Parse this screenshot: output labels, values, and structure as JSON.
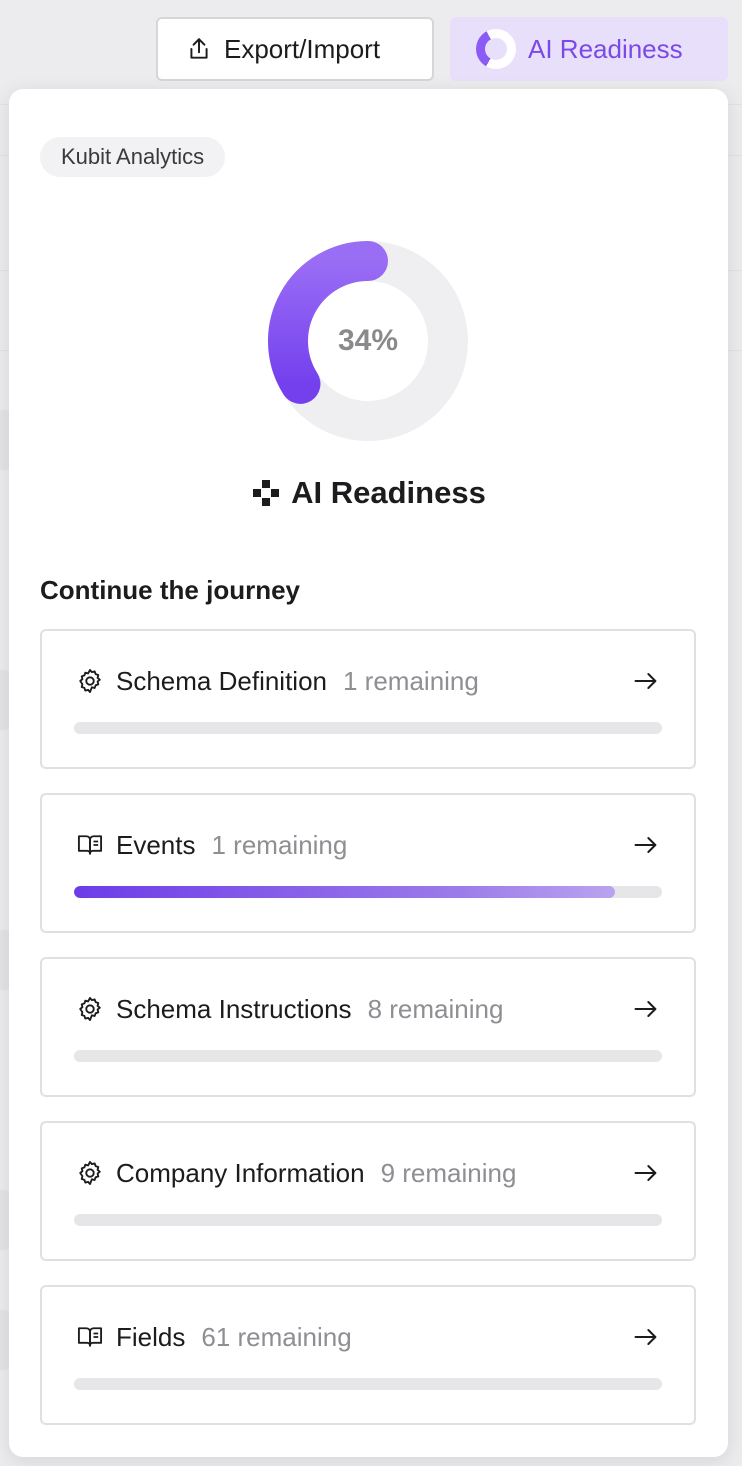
{
  "toolbar": {
    "export_label": "Export/Import",
    "readiness_label": "AI Readiness",
    "readiness_fraction": 0.34
  },
  "panel": {
    "workspace": "Kubit Analytics",
    "score": {
      "fraction": 0.34,
      "label": "34%"
    },
    "title": "AI Readiness",
    "journey_heading": "Continue the journey",
    "items": [
      {
        "icon": "gear-icon",
        "title": "Schema Definition",
        "remaining": "1 remaining",
        "progress": 0
      },
      {
        "icon": "book-icon",
        "title": "Events",
        "remaining": "1 remaining",
        "progress": 0.92
      },
      {
        "icon": "gear-icon",
        "title": "Schema Instructions",
        "remaining": "8 remaining",
        "progress": 0
      },
      {
        "icon": "gear-icon",
        "title": "Company Information",
        "remaining": "9 remaining",
        "progress": 0
      },
      {
        "icon": "book-icon",
        "title": "Fields",
        "remaining": "61 remaining",
        "progress": 0
      }
    ]
  },
  "colors": {
    "accent": "#7b4ae6",
    "accent_light": "#e8e0fb",
    "track": "#efeff1"
  }
}
